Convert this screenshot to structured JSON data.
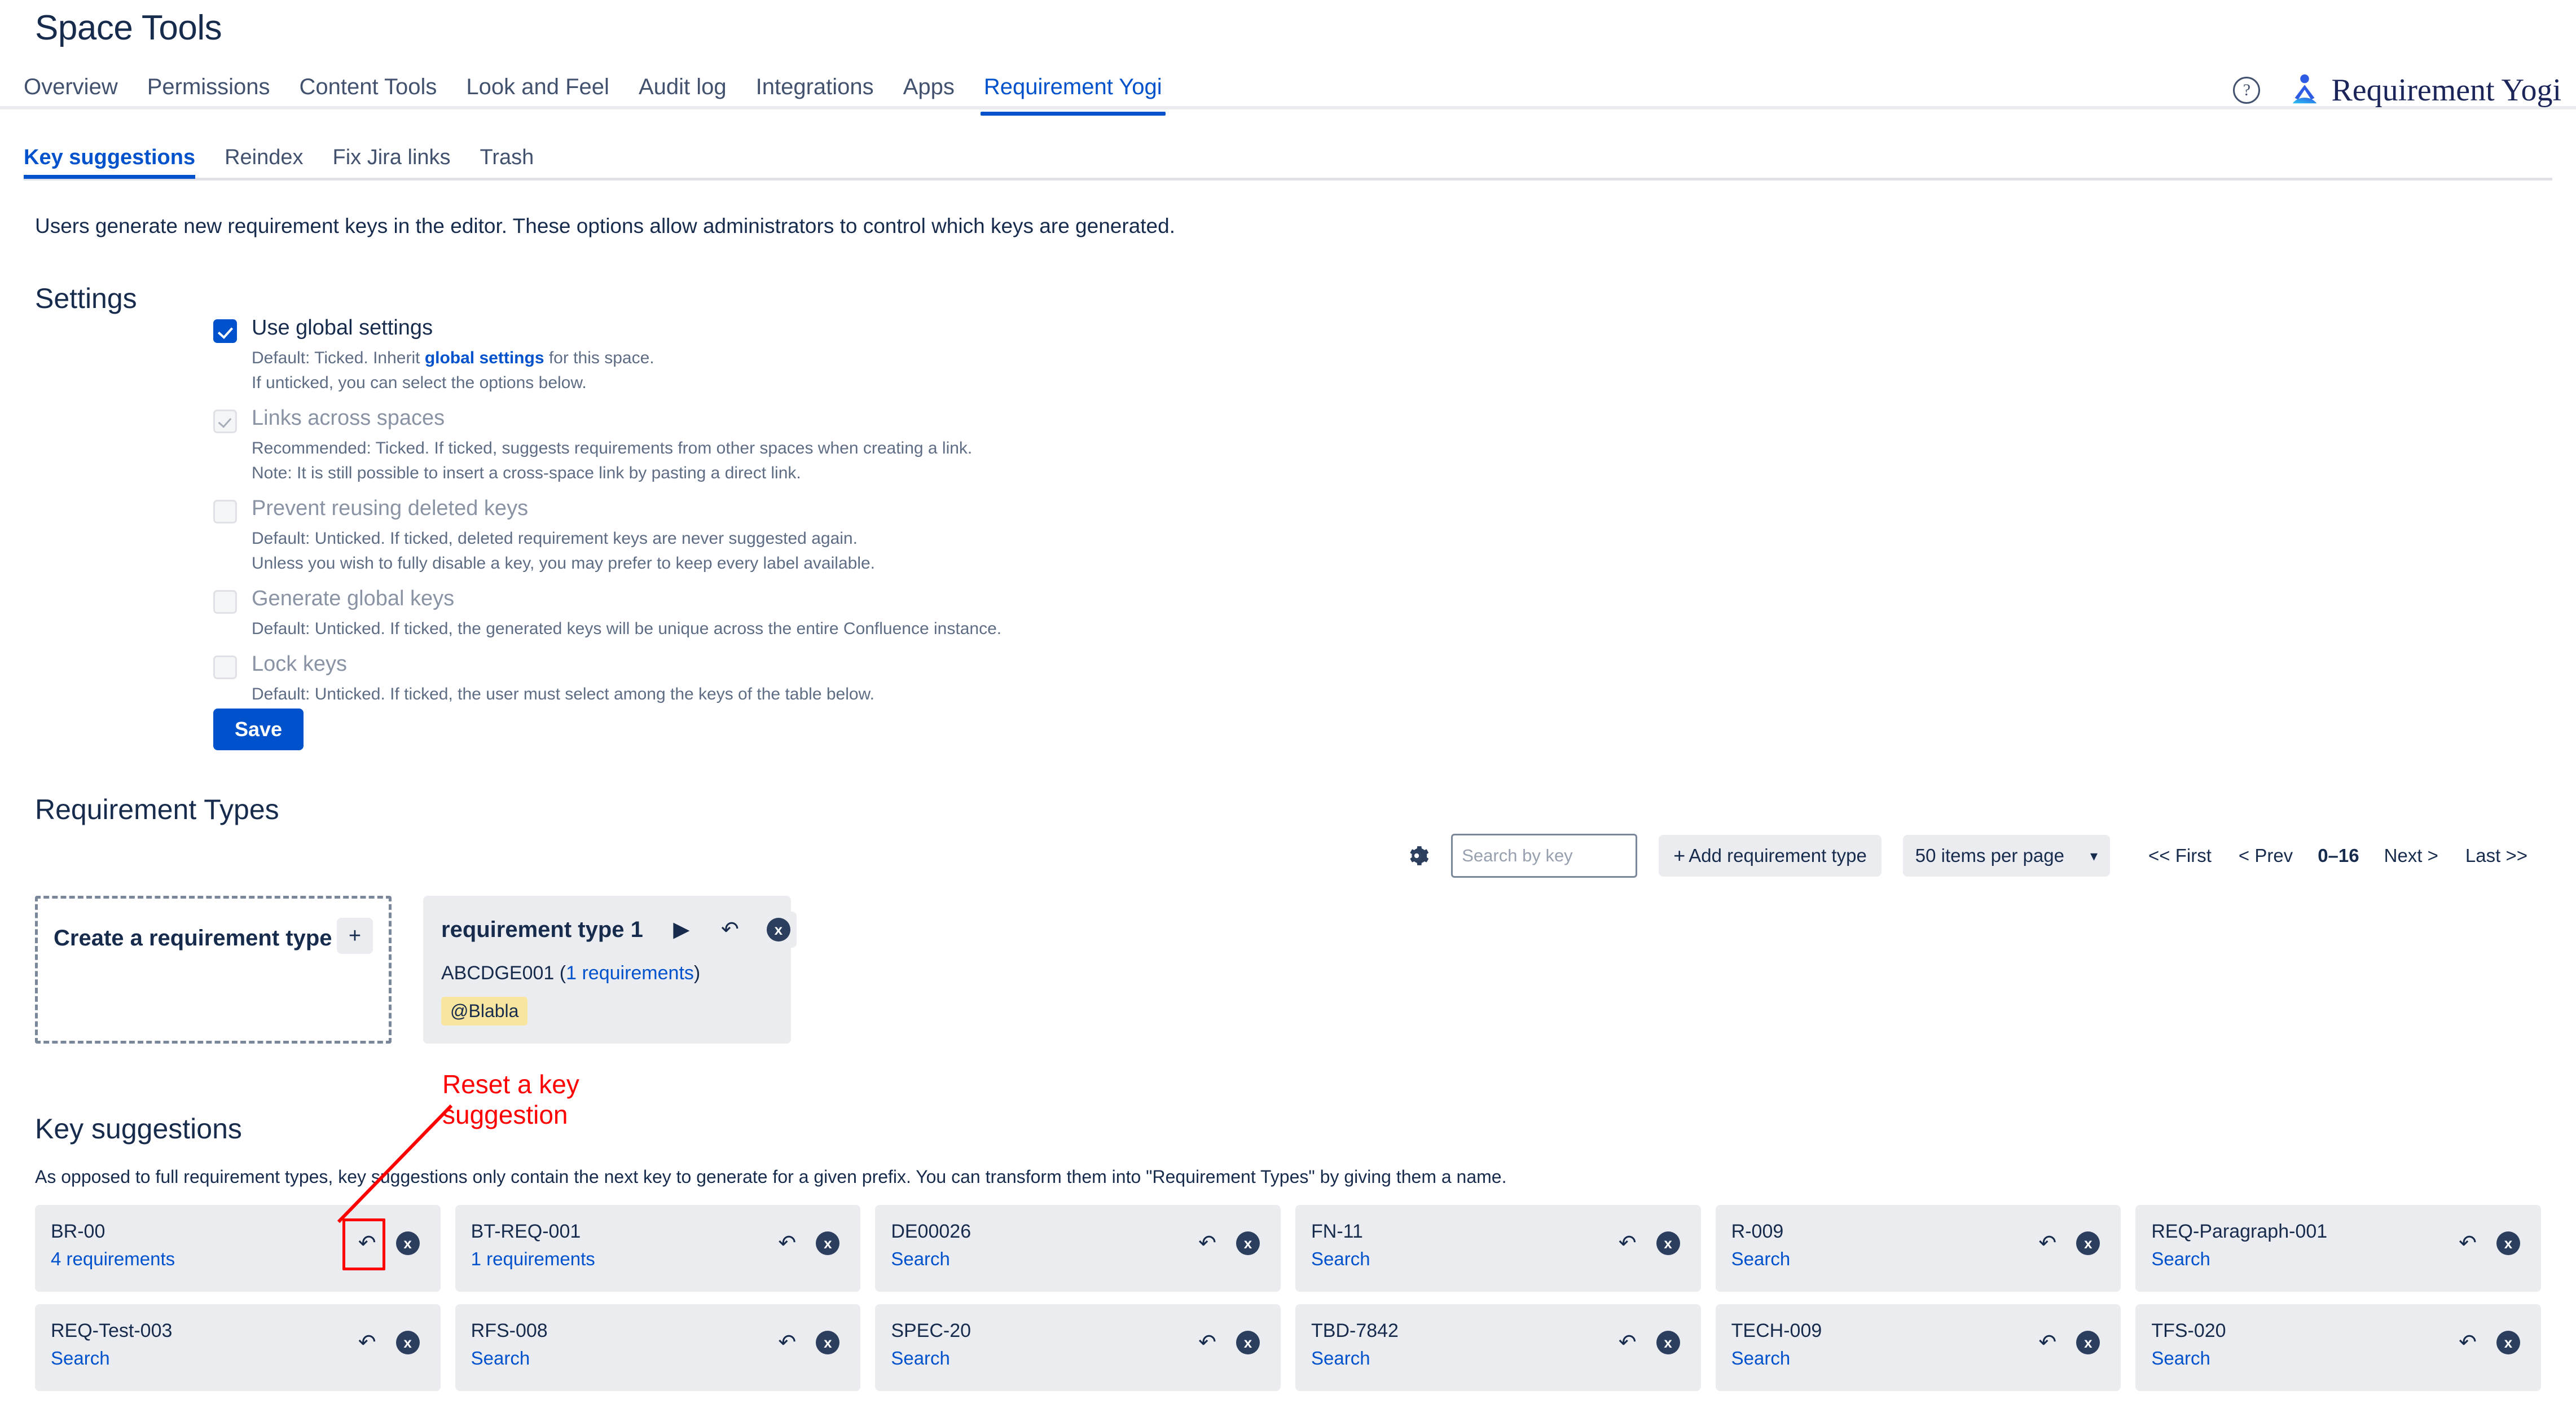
{
  "header": {
    "title": "Space Tools",
    "nav": [
      {
        "label": "Overview",
        "active": false
      },
      {
        "label": "Permissions",
        "active": false
      },
      {
        "label": "Content Tools",
        "active": false
      },
      {
        "label": "Look and Feel",
        "active": false
      },
      {
        "label": "Audit log",
        "active": false
      },
      {
        "label": "Integrations",
        "active": false
      },
      {
        "label": "Apps",
        "active": false
      },
      {
        "label": "Requirement Yogi",
        "active": true
      }
    ],
    "help_icon": "help-circle-icon",
    "brand_name": "Requirement Yogi",
    "brand_logo_icon": "yogi-logo-icon"
  },
  "subtabs": [
    {
      "label": "Key suggestions",
      "active": true
    },
    {
      "label": "Reindex",
      "active": false
    },
    {
      "label": "Fix Jira links",
      "active": false
    },
    {
      "label": "Trash",
      "active": false
    }
  ],
  "intro": "Users generate new requirement keys in the editor. These options allow administrators to control which keys are generated.",
  "settings": {
    "heading": "Settings",
    "options": [
      {
        "label": "Use global settings",
        "state": "checked",
        "hints": [
          {
            "pre": "Default: Ticked. Inherit ",
            "link": "global settings",
            "post": " for this space."
          },
          {
            "pre": "If unticked, you can select the options below.",
            "link": "",
            "post": ""
          }
        ]
      },
      {
        "label": "Links across spaces",
        "state": "disabled-checked",
        "hints": [
          {
            "pre": "Recommended: Ticked. If ticked, suggests requirements from other spaces when creating a link.",
            "link": "",
            "post": ""
          },
          {
            "pre": "Note: It is still possible to insert a cross-space link by pasting a direct link.",
            "link": "",
            "post": ""
          }
        ]
      },
      {
        "label": "Prevent reusing deleted keys",
        "state": "disabled-unchecked",
        "hints": [
          {
            "pre": "Default: Unticked. If ticked, deleted requirement keys are never suggested again.",
            "link": "",
            "post": ""
          },
          {
            "pre": "Unless you wish to fully disable a key, you may prefer to keep every label available.",
            "link": "",
            "post": ""
          }
        ]
      },
      {
        "label": "Generate global keys",
        "state": "disabled-unchecked",
        "hints": [
          {
            "pre": "Default: Unticked. If ticked, the generated keys will be unique across the entire Confluence instance.",
            "link": "",
            "post": ""
          }
        ]
      },
      {
        "label": "Lock keys",
        "state": "disabled-unchecked",
        "hints": [
          {
            "pre": "Default: Unticked. If ticked, the user must select among the keys of the table below.",
            "link": "",
            "post": ""
          }
        ]
      }
    ],
    "save_label": "Save"
  },
  "requirement_types": {
    "heading": "Requirement Types",
    "toolbar": {
      "gear_icon": "gear-icon",
      "search_placeholder": "Search by key",
      "search_value": "",
      "add_label": "Add requirement type",
      "add_plus": "+",
      "page_size": "50 items per page",
      "caret": "∨",
      "first": "<< First",
      "prev": "< Prev",
      "range": "0–16",
      "next": "Next >",
      "last": "Last >>"
    },
    "create_card": {
      "label": "Create a requirement type",
      "plus": "+"
    },
    "cards": [
      {
        "title": "requirement type 1",
        "play_glyph": "▶",
        "undo_glyph": "↶",
        "close_glyph": "x",
        "key": "ABCDGE001",
        "count_link": "1 requirements",
        "tag": "@Blabla"
      }
    ]
  },
  "key_suggestions": {
    "heading": "Key suggestions",
    "description": "As opposed to full requirement types, key suggestions only contain the next key to generate for a given prefix. You can transform them into \"Requirement Types\" by giving them a name.",
    "undo_glyph": "↶",
    "close_glyph": "x",
    "cards": [
      {
        "key": "BR-00",
        "link": "4 requirements",
        "highlighted": true
      },
      {
        "key": "BT-REQ-001",
        "link": "1 requirements",
        "highlighted": false
      },
      {
        "key": "DE00026",
        "link": "Search",
        "highlighted": false
      },
      {
        "key": "FN-11",
        "link": "Search",
        "highlighted": false
      },
      {
        "key": "R-009",
        "link": "Search",
        "highlighted": false
      },
      {
        "key": "REQ-Paragraph-001",
        "link": "Search",
        "highlighted": false
      },
      {
        "key": "REQ-Test-003",
        "link": "Search",
        "highlighted": false
      },
      {
        "key": "RFS-008",
        "link": "Search",
        "highlighted": false
      },
      {
        "key": "SPEC-20",
        "link": "Search",
        "highlighted": false
      },
      {
        "key": "TBD-7842",
        "link": "Search",
        "highlighted": false
      },
      {
        "key": "TECH-009",
        "link": "Search",
        "highlighted": false
      },
      {
        "key": "TFS-020",
        "link": "Search",
        "highlighted": false
      }
    ]
  },
  "annotation": {
    "text": "Reset a key suggestion",
    "color": "#FF0000"
  },
  "colors": {
    "accent": "#0052CC",
    "text": "#172B4D",
    "muted": "#5E6C84",
    "card_bg": "#EBECF0",
    "tag_bg": "#F8E6A0",
    "annotation": "#FF0000"
  }
}
